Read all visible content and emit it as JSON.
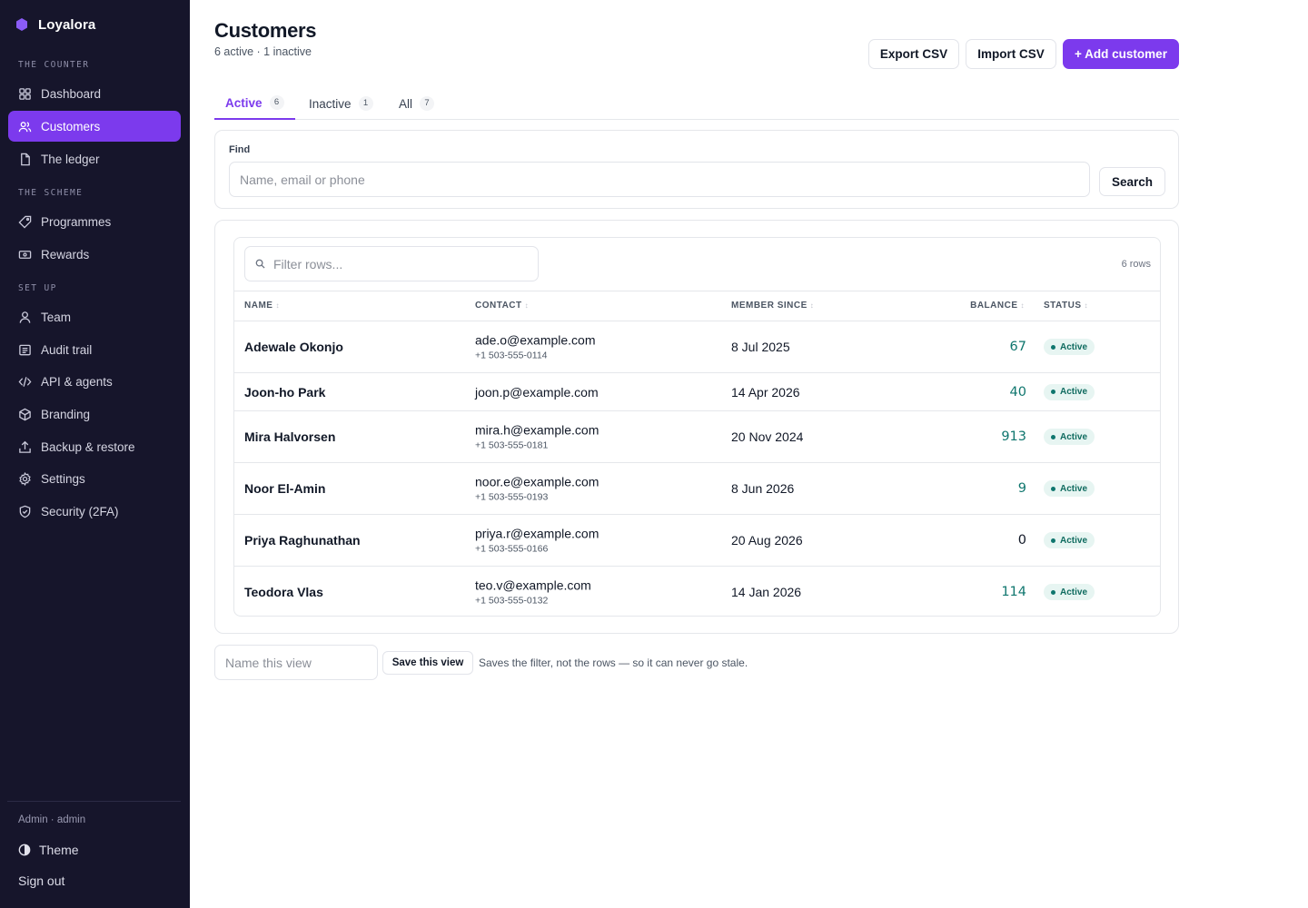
{
  "brand": {
    "name": "Loyalora",
    "accent": "#7c3aed"
  },
  "sidebar": {
    "sections": [
      {
        "label": "THE COUNTER",
        "items": [
          {
            "label": "Dashboard",
            "icon": "dashboard-icon"
          },
          {
            "label": "Customers",
            "icon": "users-icon",
            "active": true
          },
          {
            "label": "The ledger",
            "icon": "document-icon"
          }
        ]
      },
      {
        "label": "THE SCHEME",
        "items": [
          {
            "label": "Programmes",
            "icon": "tag-icon"
          },
          {
            "label": "Rewards",
            "icon": "ticket-icon"
          }
        ]
      },
      {
        "label": "SET UP",
        "items": [
          {
            "label": "Team",
            "icon": "user-icon"
          },
          {
            "label": "Audit trail",
            "icon": "list-icon"
          },
          {
            "label": "API & agents",
            "icon": "code-icon"
          },
          {
            "label": "Branding",
            "icon": "cube-icon"
          },
          {
            "label": "Backup & restore",
            "icon": "upload-icon"
          },
          {
            "label": "Settings",
            "icon": "gear-icon"
          },
          {
            "label": "Security (2FA)",
            "icon": "shield-icon"
          }
        ]
      }
    ],
    "user": "Admin · admin",
    "theme_label": "Theme",
    "signout_label": "Sign out"
  },
  "header": {
    "title": "Customers",
    "subtitle": "6 active · 1 inactive",
    "export_label": "Export CSV",
    "import_label": "Import CSV",
    "add_label": "+ Add customer"
  },
  "tabs": [
    {
      "label": "Active",
      "count": "6",
      "active": true
    },
    {
      "label": "Inactive",
      "count": "1"
    },
    {
      "label": "All",
      "count": "7"
    }
  ],
  "find": {
    "label": "Find",
    "placeholder": "Name, email or phone",
    "value": "",
    "button_label": "Search"
  },
  "table": {
    "filter_placeholder": "Filter rows...",
    "row_count": "6 rows",
    "columns": [
      "NAME",
      "CONTACT",
      "MEMBER SINCE",
      "BALANCE",
      "STATUS"
    ],
    "rows": [
      {
        "name": "Adewale Okonjo",
        "email": "ade.o@example.com",
        "phone": "+1 503-555-0114",
        "since": "8 Jul 2025",
        "balance": "67",
        "status": "Active"
      },
      {
        "name": "Joon-ho Park",
        "email": "joon.p@example.com",
        "phone": "",
        "since": "14 Apr 2026",
        "balance": "40",
        "status": "Active"
      },
      {
        "name": "Mira Halvorsen",
        "email": "mira.h@example.com",
        "phone": "+1 503-555-0181",
        "since": "20 Nov 2024",
        "balance": "913",
        "status": "Active"
      },
      {
        "name": "Noor El-Amin",
        "email": "noor.e@example.com",
        "phone": "+1 503-555-0193",
        "since": "8 Jun 2026",
        "balance": "9",
        "status": "Active"
      },
      {
        "name": "Priya Raghunathan",
        "email": "priya.r@example.com",
        "phone": "+1 503-555-0166",
        "since": "20 Aug 2026",
        "balance": "0",
        "status": "Active"
      },
      {
        "name": "Teodora Vlas",
        "email": "teo.v@example.com",
        "phone": "+1 503-555-0132",
        "since": "14 Jan 2026",
        "balance": "114",
        "status": "Active"
      }
    ]
  },
  "saved_view": {
    "placeholder": "Name this view",
    "button_label": "Save this view",
    "note": "Saves the filter, not the rows — so it can never go stale."
  }
}
